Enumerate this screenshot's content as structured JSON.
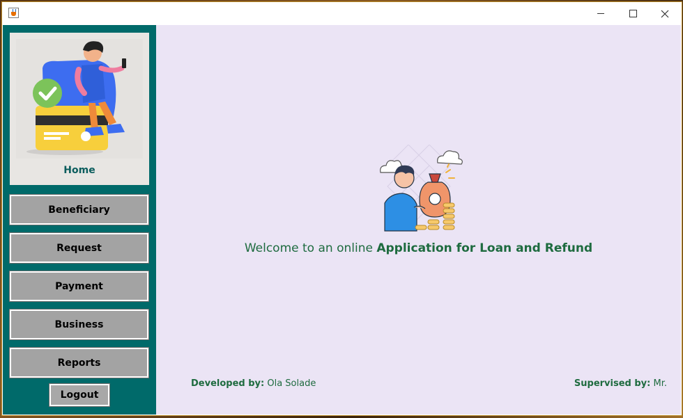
{
  "window": {
    "minimize_label": "—",
    "maximize_label": "",
    "close_label": "✕"
  },
  "sidebar": {
    "home_label": "Home",
    "items": [
      {
        "label": "Beneficiary"
      },
      {
        "label": "Request"
      },
      {
        "label": "Payment"
      },
      {
        "label": "Business"
      },
      {
        "label": "Reports"
      }
    ],
    "logout_label": "Logout"
  },
  "main": {
    "welcome_prefix": "Welcome to an online ",
    "welcome_highlight": "Application for Loan and Refund",
    "developed_label": "Developed by:",
    "developer_name": "Ola Solade",
    "supervised_label": "Supervised by:",
    "supervisor_name": "Mr."
  },
  "colors": {
    "sidebar_bg": "#006a6a",
    "main_bg": "#ebe4f5",
    "text_green": "#1e6b3f",
    "home_label": "#0b5d5d",
    "button_bg": "#a3a3a3"
  },
  "icons": {
    "app": "java-cup-icon",
    "home_illustration": "person-on-card-illustration",
    "welcome_illustration": "person-with-money-bag-illustration"
  }
}
